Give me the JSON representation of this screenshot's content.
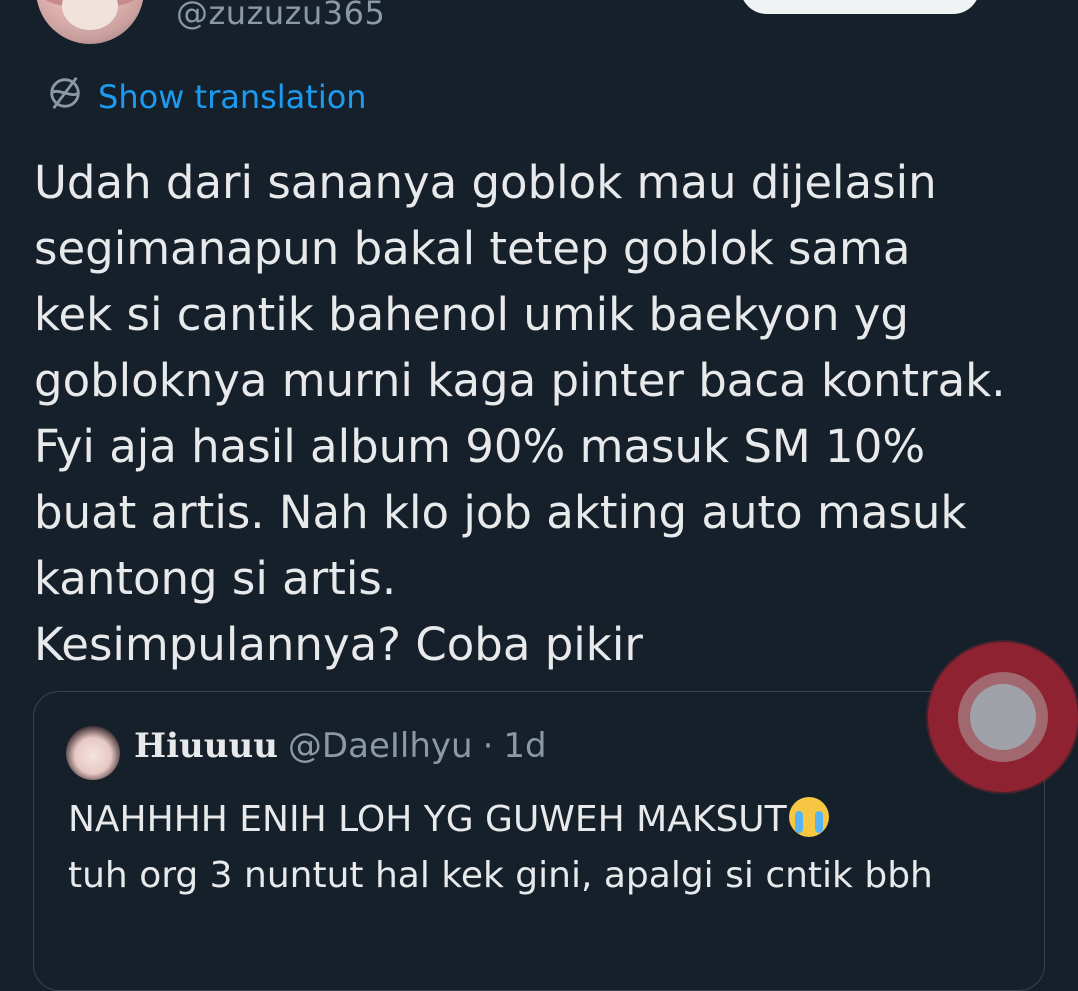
{
  "author": {
    "handle": "@zuzuzu365"
  },
  "translate": {
    "label": "Show translation",
    "icon": "globe-slash-icon",
    "color": "#1d9bf0"
  },
  "tweet": {
    "text": "Udah dari sananya goblok mau dijelasin\nsegimanapun bakal tetep goblok sama\nkek si cantik bahenol umik baekyon yg\ngobloknya murni kaga pinter baca kontrak.\nFyi aja hasil album 90% masuk SM 10%\nbuat artis. Nah klo job akting auto masuk\nkantong si artis.\nKesimpulannya? Coba pikir"
  },
  "quote": {
    "name": "Hiuuuu",
    "handle": "@DaeIlhyu",
    "separator": "·",
    "time": "1d",
    "line1": "NAHHHH ENIH LOH YG GUWEH MAKSUT",
    "emoji": "loudly-crying-face-icon",
    "line2": "tuh org 3 nuntut hal kek gini, apalgi si cntik bbh"
  },
  "colors": {
    "background": "#16202b",
    "text": "#e7e9ea",
    "secondary": "#8b98a5",
    "border": "#38444d"
  }
}
